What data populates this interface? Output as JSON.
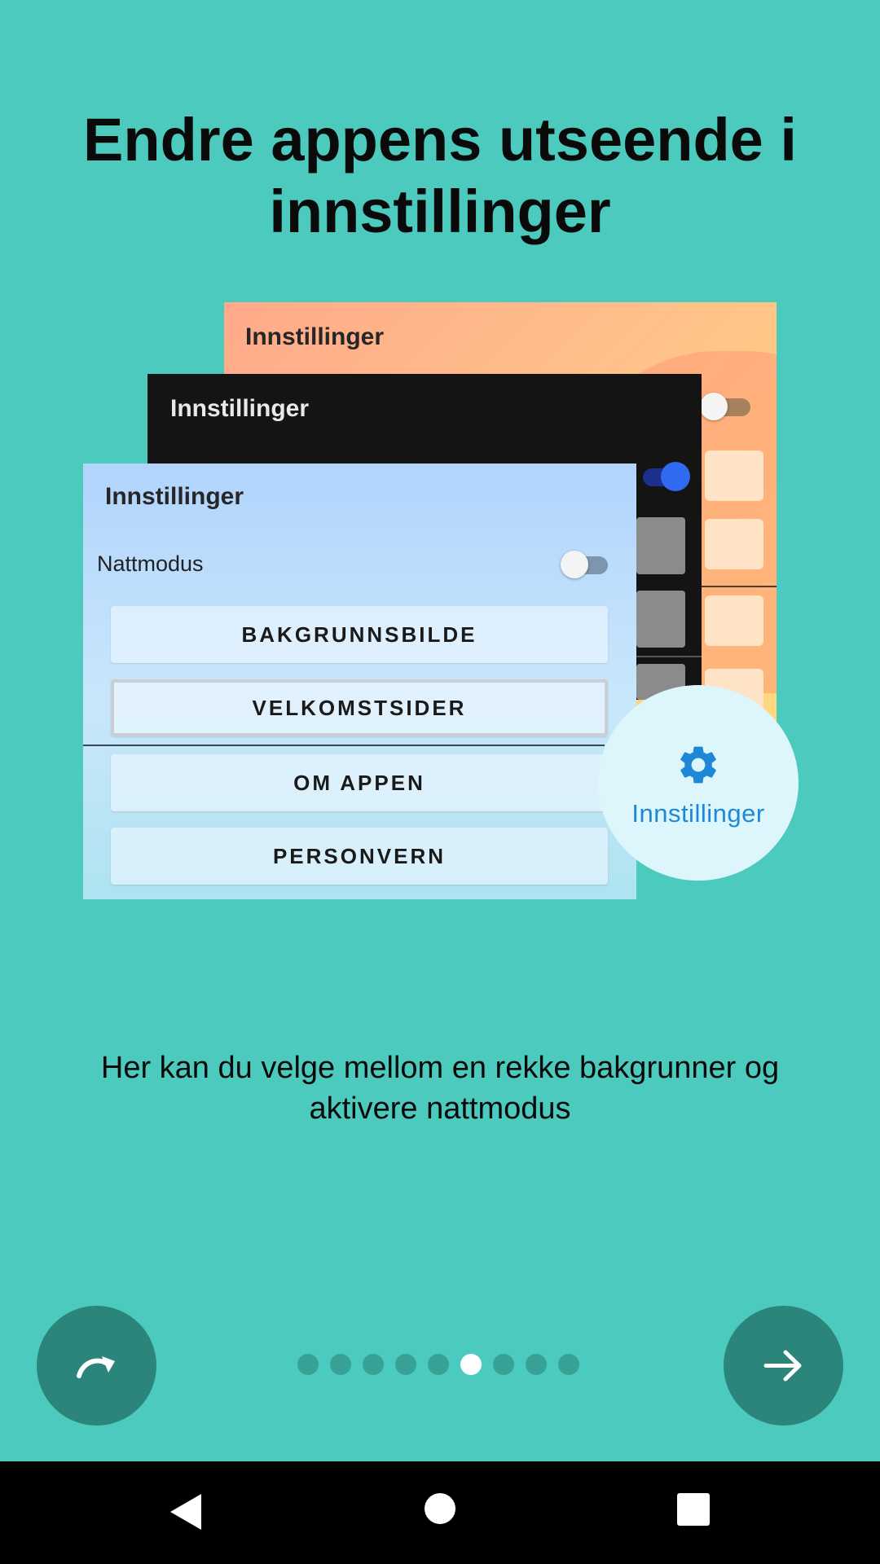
{
  "title": {
    "line1": "Endre appens utseende i",
    "line2": "innstillinger"
  },
  "illustration": {
    "orange_card": {
      "title": "Innstillinger"
    },
    "dark_card": {
      "title": "Innstillinger"
    },
    "blue_card": {
      "title": "Innstillinger",
      "night_mode_label": "Nattmodus",
      "night_mode_on": false,
      "buttons": [
        "BAKGRUNNSBILDE",
        "VELKOMSTSIDER",
        "OM APPEN",
        "PERSONVERN"
      ],
      "selected_button": "VELKOMSTSIDER"
    },
    "settings_badge": {
      "label": "Innstillinger",
      "icon": "gear-icon",
      "color": "#1f88d6"
    }
  },
  "description": {
    "line1": "Her kan du velge mellom en rekke bakgrunner og",
    "line2": "aktivere nattmodus"
  },
  "pager": {
    "total_pages": 9,
    "current_page": 6
  },
  "controls": {
    "skip_icon": "redo-arrow-icon",
    "next_icon": "arrow-right-icon"
  },
  "system_nav": {
    "back_icon": "back-triangle-icon",
    "home_icon": "home-circle-icon",
    "recents_icon": "recents-square-icon"
  },
  "colors": {
    "background": "#4ccabd",
    "button_fill": "#2c857b",
    "dot_inactive": "#37a196",
    "dot_active": "#ffffff"
  }
}
